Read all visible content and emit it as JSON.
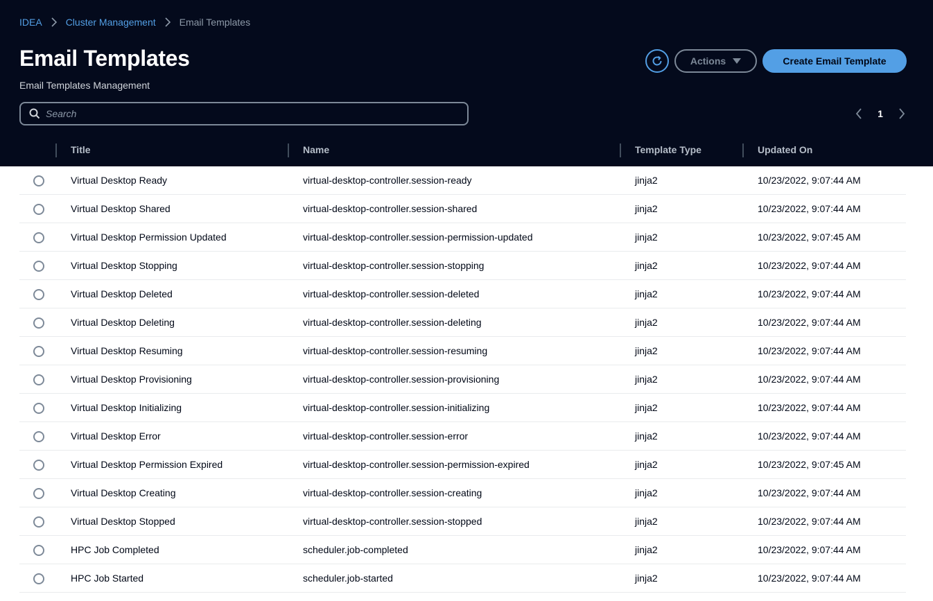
{
  "breadcrumb": {
    "items": [
      {
        "label": "IDEA"
      },
      {
        "label": "Cluster Management"
      },
      {
        "label": "Email Templates"
      }
    ]
  },
  "page": {
    "title": "Email Templates",
    "subtitle": "Email Templates Management"
  },
  "toolbar": {
    "refresh_icon": "refresh-icon",
    "actions_label": "Actions",
    "create_label": "Create Email Template"
  },
  "search": {
    "placeholder": "Search",
    "value": ""
  },
  "pagination": {
    "current_page": "1"
  },
  "table": {
    "columns": [
      "Title",
      "Name",
      "Template Type",
      "Updated On"
    ],
    "rows": [
      {
        "title": "Virtual Desktop Ready",
        "name": "virtual-desktop-controller.session-ready",
        "type": "jinja2",
        "updated": "10/23/2022, 9:07:44 AM"
      },
      {
        "title": "Virtual Desktop Shared",
        "name": "virtual-desktop-controller.session-shared",
        "type": "jinja2",
        "updated": "10/23/2022, 9:07:44 AM"
      },
      {
        "title": "Virtual Desktop Permission Updated",
        "name": "virtual-desktop-controller.session-permission-updated",
        "type": "jinja2",
        "updated": "10/23/2022, 9:07:45 AM"
      },
      {
        "title": "Virtual Desktop Stopping",
        "name": "virtual-desktop-controller.session-stopping",
        "type": "jinja2",
        "updated": "10/23/2022, 9:07:44 AM"
      },
      {
        "title": "Virtual Desktop Deleted",
        "name": "virtual-desktop-controller.session-deleted",
        "type": "jinja2",
        "updated": "10/23/2022, 9:07:44 AM"
      },
      {
        "title": "Virtual Desktop Deleting",
        "name": "virtual-desktop-controller.session-deleting",
        "type": "jinja2",
        "updated": "10/23/2022, 9:07:44 AM"
      },
      {
        "title": "Virtual Desktop Resuming",
        "name": "virtual-desktop-controller.session-resuming",
        "type": "jinja2",
        "updated": "10/23/2022, 9:07:44 AM"
      },
      {
        "title": "Virtual Desktop Provisioning",
        "name": "virtual-desktop-controller.session-provisioning",
        "type": "jinja2",
        "updated": "10/23/2022, 9:07:44 AM"
      },
      {
        "title": "Virtual Desktop Initializing",
        "name": "virtual-desktop-controller.session-initializing",
        "type": "jinja2",
        "updated": "10/23/2022, 9:07:44 AM"
      },
      {
        "title": "Virtual Desktop Error",
        "name": "virtual-desktop-controller.session-error",
        "type": "jinja2",
        "updated": "10/23/2022, 9:07:44 AM"
      },
      {
        "title": "Virtual Desktop Permission Expired",
        "name": "virtual-desktop-controller.session-permission-expired",
        "type": "jinja2",
        "updated": "10/23/2022, 9:07:45 AM"
      },
      {
        "title": "Virtual Desktop Creating",
        "name": "virtual-desktop-controller.session-creating",
        "type": "jinja2",
        "updated": "10/23/2022, 9:07:44 AM"
      },
      {
        "title": "Virtual Desktop Stopped",
        "name": "virtual-desktop-controller.session-stopped",
        "type": "jinja2",
        "updated": "10/23/2022, 9:07:44 AM"
      },
      {
        "title": "HPC Job Completed",
        "name": "scheduler.job-completed",
        "type": "jinja2",
        "updated": "10/23/2022, 9:07:44 AM"
      },
      {
        "title": "HPC Job Started",
        "name": "scheduler.job-started",
        "type": "jinja2",
        "updated": "10/23/2022, 9:07:44 AM"
      }
    ]
  },
  "colors": {
    "header_bg": "#040a1c",
    "accent": "#539fe5",
    "muted": "#7d8998"
  }
}
